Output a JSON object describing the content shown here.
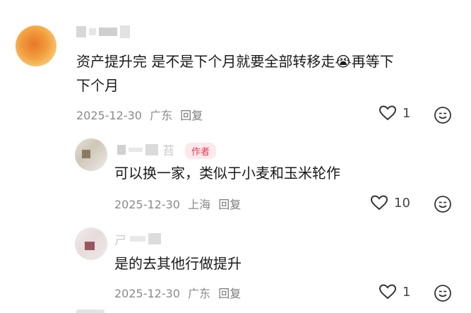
{
  "comments": [
    {
      "text_line1": "资产提升完 是不是下个月就要全部转移走",
      "text_emoji": "😭",
      "text_line1b": "再等下",
      "text_line2": "下个月",
      "date": "2025-12-30",
      "location": "广东",
      "reply_label": "回复",
      "likes": "1"
    },
    {
      "name_char": "苔",
      "author_tag": "作者",
      "text": "可以换一家，类似于小麦和玉米轮作",
      "date": "2025-12-30",
      "location": "上海",
      "reply_label": "回复",
      "likes": "10"
    },
    {
      "name_char": "ㄕ",
      "text": "是的去其他行做提升",
      "date": "2025-12-30",
      "location": "广东",
      "reply_label": "回复",
      "likes": "1"
    }
  ],
  "colors": {
    "meta": "#8a8a8a",
    "author_tag_text": "#e8384f",
    "author_tag_bg": "#fde8ec"
  },
  "icons": [
    "heart-outline-icon",
    "emoji-face-icon"
  ]
}
